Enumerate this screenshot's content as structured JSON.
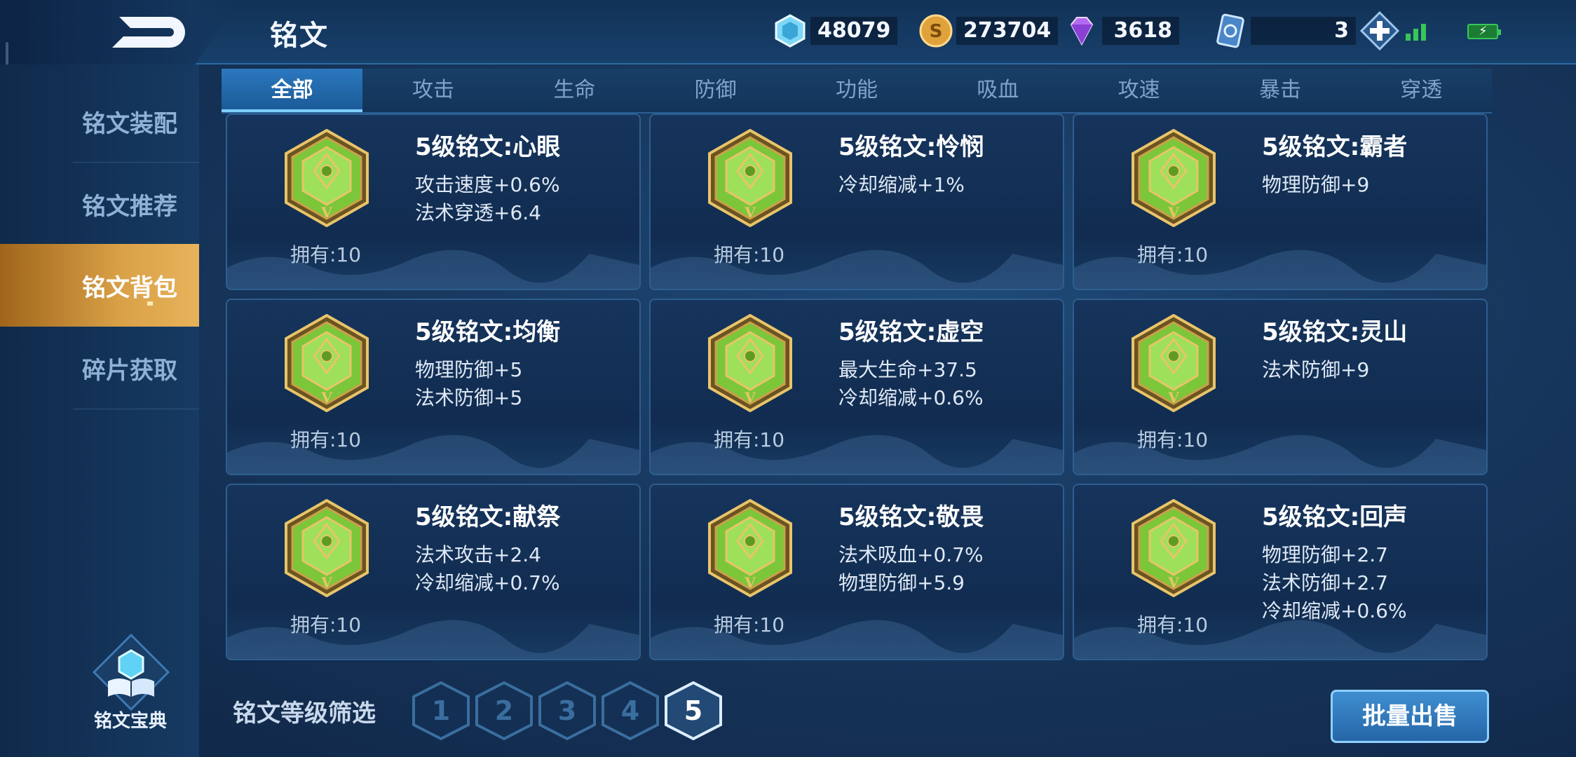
{
  "header": {
    "title": "铭文"
  },
  "currencies": [
    {
      "name": "crystal",
      "value": "48079",
      "icon": "crystal-icon"
    },
    {
      "name": "coin",
      "value": "273704",
      "icon": "gold-coin-icon"
    },
    {
      "name": "diamond",
      "value": "3618",
      "icon": "diamond-icon"
    },
    {
      "name": "card",
      "value": "3",
      "icon": "card-icon"
    }
  ],
  "sidebar": {
    "items": [
      {
        "label": "铭文装配"
      },
      {
        "label": "铭文推荐"
      },
      {
        "label": "铭文背包"
      },
      {
        "label": "碎片获取"
      }
    ],
    "active_index": 2,
    "codex_label": "铭文宝典"
  },
  "tabs": {
    "items": [
      "全部",
      "攻击",
      "生命",
      "防御",
      "功能",
      "吸血",
      "攻速",
      "暴击",
      "穿透"
    ],
    "active_index": 0
  },
  "cards": [
    {
      "name": "5级铭文:心眼",
      "stats": [
        "攻击速度+0.6%",
        "法术穿透+6.4"
      ],
      "owned": "拥有:10"
    },
    {
      "name": "5级铭文:怜悯",
      "stats": [
        "冷却缩减+1%"
      ],
      "owned": "拥有:10"
    },
    {
      "name": "5级铭文:霸者",
      "stats": [
        "物理防御+9"
      ],
      "owned": "拥有:10"
    },
    {
      "name": "5级铭文:均衡",
      "stats": [
        "物理防御+5",
        "法术防御+5"
      ],
      "owned": "拥有:10"
    },
    {
      "name": "5级铭文:虚空",
      "stats": [
        "最大生命+37.5",
        "冷却缩减+0.6%"
      ],
      "owned": "拥有:10"
    },
    {
      "name": "5级铭文:灵山",
      "stats": [
        "法术防御+9"
      ],
      "owned": "拥有:10"
    },
    {
      "name": "5级铭文:献祭",
      "stats": [
        "法术攻击+2.4",
        "冷却缩减+0.7%"
      ],
      "owned": "拥有:10"
    },
    {
      "name": "5级铭文:敬畏",
      "stats": [
        "法术吸血+0.7%",
        "物理防御+5.9"
      ],
      "owned": "拥有:10"
    },
    {
      "name": "5级铭文:回声",
      "stats": [
        "物理防御+2.7",
        "法术防御+2.7",
        "冷却缩减+0.6%"
      ],
      "owned": "拥有:10"
    }
  ],
  "level_filter": {
    "label": "铭文等级筛选",
    "levels": [
      "1",
      "2",
      "3",
      "4",
      "5"
    ],
    "active_index": 4
  },
  "batch_sell_label": "批量出售",
  "emblem_numeral": "V",
  "colors": {
    "accent_gold": "#d9a047",
    "emblem_green": "#7cc63a",
    "tab_active": "#2b78bf"
  }
}
